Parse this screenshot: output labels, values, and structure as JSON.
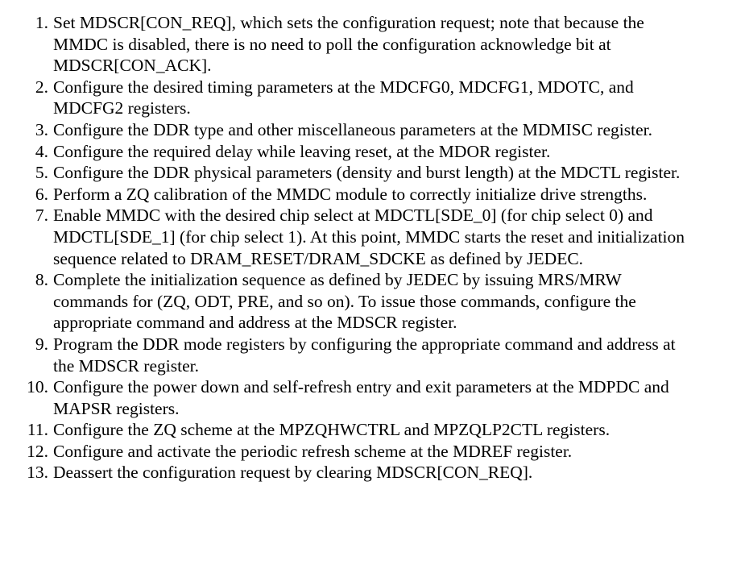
{
  "document": {
    "steps": [
      {
        "number": "1.",
        "text": "Set MDSCR[CON_REQ], which sets the configuration request; note that because the MMDC is disabled, there is no need to poll the configuration acknowledge bit at MDSCR[CON_ACK]."
      },
      {
        "number": "2.",
        "text": "Configure the desired timing parameters at the MDCFG0, MDCFG1, MDOTC, and MDCFG2 registers."
      },
      {
        "number": "3.",
        "text": "Configure the DDR type and other miscellaneous parameters at the MDMISC register."
      },
      {
        "number": "4.",
        "text": "Configure the required delay while leaving reset, at the MDOR register."
      },
      {
        "number": "5.",
        "text": "Configure the DDR physical parameters (density and burst length) at the MDCTL register."
      },
      {
        "number": "6.",
        "text": "Perform a ZQ calibration of the MMDC module to correctly initialize drive strengths."
      },
      {
        "number": "7.",
        "text": "Enable MMDC with the desired chip select at MDCTL[SDE_0] (for chip select 0) and MDCTL[SDE_1] (for chip select 1). At this point, MMDC starts the reset and initialization sequence related to DRAM_RESET/DRAM_SDCKE as defined by JEDEC."
      },
      {
        "number": "8.",
        "text": "Complete the initialization sequence as defined by JEDEC by issuing MRS/MRW commands for (ZQ, ODT, PRE, and so on). To issue those commands, configure the appropriate command and address at the MDSCR register."
      },
      {
        "number": "9.",
        "text": "Program the DDR mode registers by configuring the appropriate command and address at the MDSCR register."
      },
      {
        "number": "10.",
        "text": "Configure the power down and self-refresh entry and exit parameters at the MDPDC and MAPSR registers."
      },
      {
        "number": "11.",
        "text": "Configure the ZQ scheme at the MPZQHWCTRL and MPZQLP2CTL registers."
      },
      {
        "number": "12.",
        "text": "Configure and activate the periodic refresh scheme at the MDREF register."
      },
      {
        "number": "13.",
        "text": "Deassert the configuration request by clearing MDSCR[CON_REQ]."
      }
    ]
  }
}
